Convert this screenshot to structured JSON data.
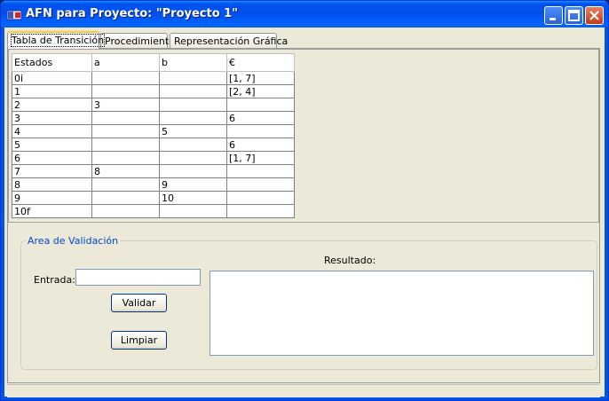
{
  "window": {
    "title": "AFN para Proyecto: \"Proyecto 1\"",
    "icon": "java-cup-icon"
  },
  "tabs": [
    {
      "label": "Tabla de Transición",
      "active": true
    },
    {
      "label": "Procedimiento",
      "active": false
    },
    {
      "label": "Representación Gráfica",
      "active": false
    }
  ],
  "table": {
    "headers": [
      "Estados",
      "a",
      "b",
      "€"
    ],
    "rows": [
      [
        "0i",
        "",
        "",
        "[1, 7]"
      ],
      [
        "1",
        "",
        "",
        "[2, 4]"
      ],
      [
        "2",
        "3",
        "",
        ""
      ],
      [
        "3",
        "",
        "",
        "6"
      ],
      [
        "4",
        "",
        "5",
        ""
      ],
      [
        "5",
        "",
        "",
        "6"
      ],
      [
        "6",
        "",
        "",
        "[1, 7]"
      ],
      [
        "7",
        "8",
        "",
        ""
      ],
      [
        "8",
        "",
        "9",
        ""
      ],
      [
        "9",
        "",
        "10",
        ""
      ],
      [
        "10f",
        "",
        "",
        ""
      ]
    ]
  },
  "validation": {
    "legend": "Area de Validación",
    "entrada_label": "Entrada:",
    "entrada_value": "",
    "resultado_label": "Resultado:",
    "resultado_value": "",
    "validar_label": "Validar",
    "limpiar_label": "Limpiar"
  }
}
